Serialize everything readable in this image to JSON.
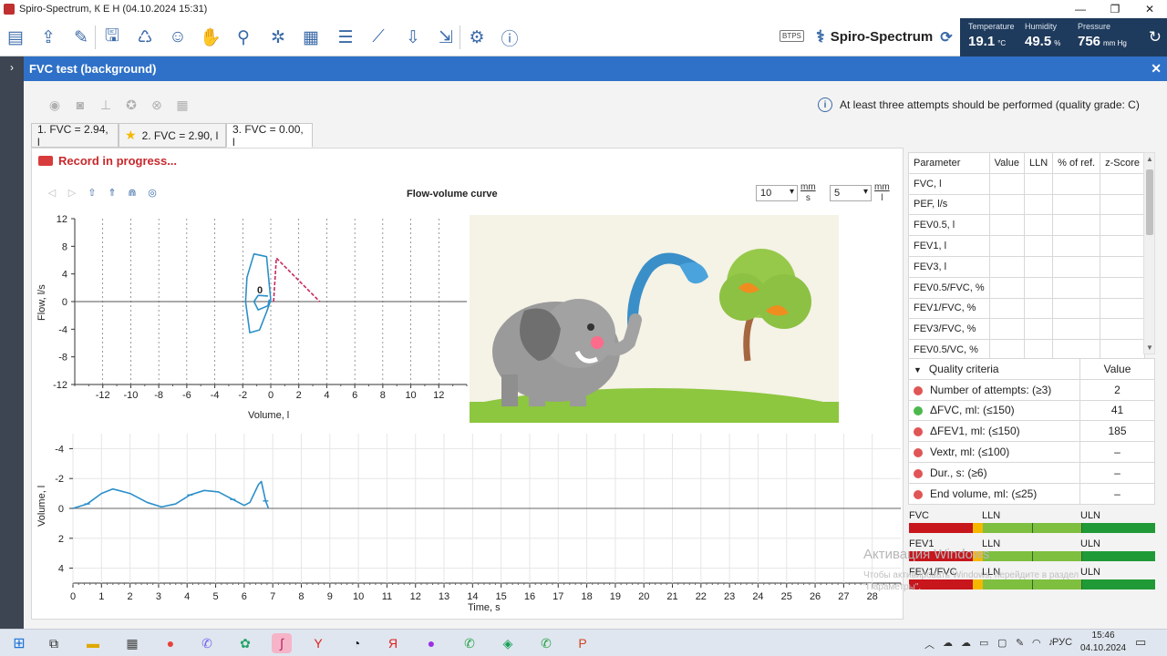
{
  "window": {
    "title": "Spiro-Spectrum, К Е Н (04.10.2024 15:31)"
  },
  "toolbar": {
    "btps": "BTPS",
    "product": "Spiro-Spectrum"
  },
  "weather": {
    "temperature": {
      "label": "Temperature",
      "value": "19.1",
      "unit": "°C"
    },
    "humidity": {
      "label": "Humidity",
      "value": "49.5",
      "unit": "%"
    },
    "pressure": {
      "label": "Pressure",
      "value": "756",
      "unit": "mm Hg"
    }
  },
  "header": {
    "title": "FVC test (background)"
  },
  "info_message": "At least three attempts should be performed (quality grade: C)",
  "tabs": [
    {
      "label": "1. FVC = 2.94, l",
      "starred": false,
      "active": false
    },
    {
      "label": "2. FVC = 2.90, l",
      "starred": true,
      "active": false
    },
    {
      "label": "3. FVC = 0.00, l",
      "starred": false,
      "active": true
    }
  ],
  "record_status": "Record in progress...",
  "flow_chart": {
    "title": "Flow-volume curve",
    "scale1": "10",
    "scale1_unit_top": "mm",
    "scale1_unit_bottom": "s",
    "scale2": "5",
    "scale2_unit_top": "mm",
    "scale2_unit_bottom": "l",
    "marker_label": "0"
  },
  "chart_data": [
    {
      "type": "line",
      "title": "Flow-volume curve",
      "xlabel": "Volume, l",
      "ylabel": "Flow, l/s",
      "xlim": [
        -14,
        14
      ],
      "ylim": [
        -12,
        12
      ],
      "x_ticks": [
        -12,
        -10,
        -8,
        -6,
        -4,
        -2,
        0,
        2,
        4,
        6,
        8,
        10,
        12
      ],
      "y_ticks": [
        12,
        8,
        4,
        0,
        -4,
        -8,
        -12
      ],
      "series": [
        {
          "values": [
            {
              "x": 0,
              "y": 0.2
            },
            {
              "x": -0.3,
              "y": 6.5
            },
            {
              "x": -1.2,
              "y": 6.9
            },
            {
              "x": -1.7,
              "y": 3.5
            },
            {
              "x": -1.8,
              "y": 0
            },
            {
              "x": -1.5,
              "y": -4.5
            },
            {
              "x": -0.8,
              "y": -4.1
            },
            {
              "x": -0.3,
              "y": -1.5
            },
            {
              "x": 0,
              "y": 0.2
            }
          ]
        },
        {
          "values": [
            {
              "x": -0.2,
              "y": 0.8
            },
            {
              "x": -0.9,
              "y": 0.9
            },
            {
              "x": -1.2,
              "y": 0
            },
            {
              "x": -0.9,
              "y": -1.2
            },
            {
              "x": -0.2,
              "y": -0.6
            },
            {
              "x": -0.1,
              "y": 0.3
            }
          ]
        },
        {
          "values": [
            {
              "x": 0.2,
              "y": 0
            },
            {
              "x": 0.4,
              "y": 6.3
            },
            {
              "x": 3.5,
              "y": 0
            }
          ]
        }
      ]
    },
    {
      "type": "line",
      "xlabel": "Time, s",
      "ylabel": "Volume, l",
      "xlim": [
        0,
        29
      ],
      "ylim": [
        5,
        -5
      ],
      "x_ticks": [
        0,
        1,
        2,
        3,
        4,
        5,
        6,
        7,
        8,
        9,
        10,
        11,
        12,
        13,
        14,
        15,
        16,
        17,
        18,
        19,
        20,
        21,
        22,
        23,
        24,
        25,
        26,
        27,
        28
      ],
      "y_ticks": [
        -4,
        -2,
        0,
        2,
        4
      ],
      "series": [
        {
          "values": [
            {
              "x": 0,
              "y": 0
            },
            {
              "x": 0.5,
              "y": -0.3
            },
            {
              "x": 1.0,
              "y": -1.0
            },
            {
              "x": 1.4,
              "y": -1.3
            },
            {
              "x": 2.0,
              "y": -1.0
            },
            {
              "x": 2.6,
              "y": -0.4
            },
            {
              "x": 3.1,
              "y": -0.1
            },
            {
              "x": 3.6,
              "y": -0.3
            },
            {
              "x": 4.1,
              "y": -0.9
            },
            {
              "x": 4.6,
              "y": -1.2
            },
            {
              "x": 5.1,
              "y": -1.1
            },
            {
              "x": 5.6,
              "y": -0.6
            },
            {
              "x": 6.0,
              "y": -0.2
            },
            {
              "x": 6.2,
              "y": -0.4
            },
            {
              "x": 6.5,
              "y": -1.6
            },
            {
              "x": 6.6,
              "y": -1.8
            },
            {
              "x": 6.75,
              "y": -0.5
            },
            {
              "x": 6.85,
              "y": 0
            }
          ]
        }
      ]
    }
  ],
  "param_table": {
    "headers": [
      "Parameter",
      "Value",
      "LLN",
      "% of ref.",
      "z-Score"
    ],
    "rows": [
      "FVC, l",
      "PEF, l/s",
      "FEV0.5, l",
      "FEV1, l",
      "FEV3, l",
      "FEV0.5/FVC, %",
      "FEV1/FVC, %",
      "FEV3/FVC, %",
      "FEV0.5/VC, %"
    ]
  },
  "quality": {
    "header_label": "Quality criteria",
    "header_value": "Value",
    "rows": [
      {
        "label": "Number of attempts: (≥3)",
        "value": "2",
        "status": "red"
      },
      {
        "label": "ΔFVC, ml: (≤150)",
        "value": "41",
        "status": "green"
      },
      {
        "label": "ΔFEV1, ml: (≤150)",
        "value": "185",
        "status": "red"
      },
      {
        "label": "Vextr, ml: (≤100)",
        "value": "–",
        "status": "red"
      },
      {
        "label": "Dur., s: (≥6)",
        "value": "–",
        "status": "red"
      },
      {
        "label": "End volume, ml: (≤25)",
        "value": "–",
        "status": "red"
      }
    ]
  },
  "bars": [
    {
      "name": "FVC",
      "lln": "LLN",
      "uln": "ULN"
    },
    {
      "name": "FEV1",
      "lln": "LLN",
      "uln": "ULN"
    },
    {
      "name": "FEV1/FVC",
      "lln": "LLN",
      "uln": "ULN"
    }
  ],
  "watermark": {
    "line1": "Активация Windows",
    "line2": "Чтобы активировать Windows, перейдите в раздел \"Параметры\"."
  },
  "taskbar": {
    "lang": "РУС",
    "time": "15:46",
    "date": "04.10.2024"
  },
  "colors": {
    "accent": "#2f71c8",
    "curve": "#2b8fc9",
    "dashed": "#c8285a",
    "red": "#c8161d",
    "green": "#1f9a36"
  }
}
